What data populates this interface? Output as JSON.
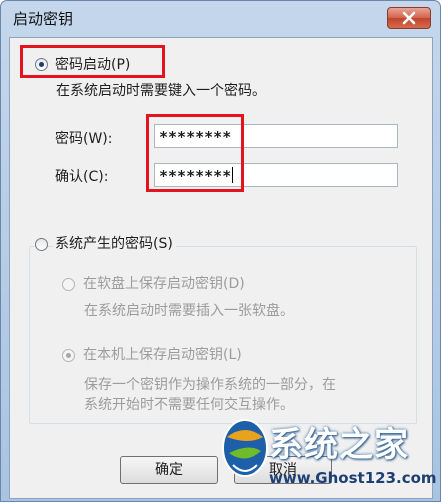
{
  "window": {
    "title": "启动密钥",
    "close_label": "×"
  },
  "password_option": {
    "label": "密码启动(P)",
    "description": "在系统启动时需要键入一个密码。",
    "selected": true
  },
  "fields": {
    "password": {
      "label": "密码(W):",
      "value": "********"
    },
    "confirm": {
      "label": "确认(C):",
      "value": "********"
    }
  },
  "system_option": {
    "label": "系统产生的密码(S)",
    "selected": false,
    "floppy": {
      "label": "在软盘上保存启动密钥(D)",
      "description": "在系统启动时需要插入一张软盘。"
    },
    "local": {
      "label": "在本机上保存启动密钥(L)",
      "description_line1": "保存一个密钥作为操作系统的一部分，在",
      "description_line2": "系统开始时不需要任何交互操作。"
    }
  },
  "buttons": {
    "ok": "确定",
    "cancel": "取消"
  },
  "watermark": {
    "name": "系统之家",
    "url": "www.Ghost123.com"
  }
}
